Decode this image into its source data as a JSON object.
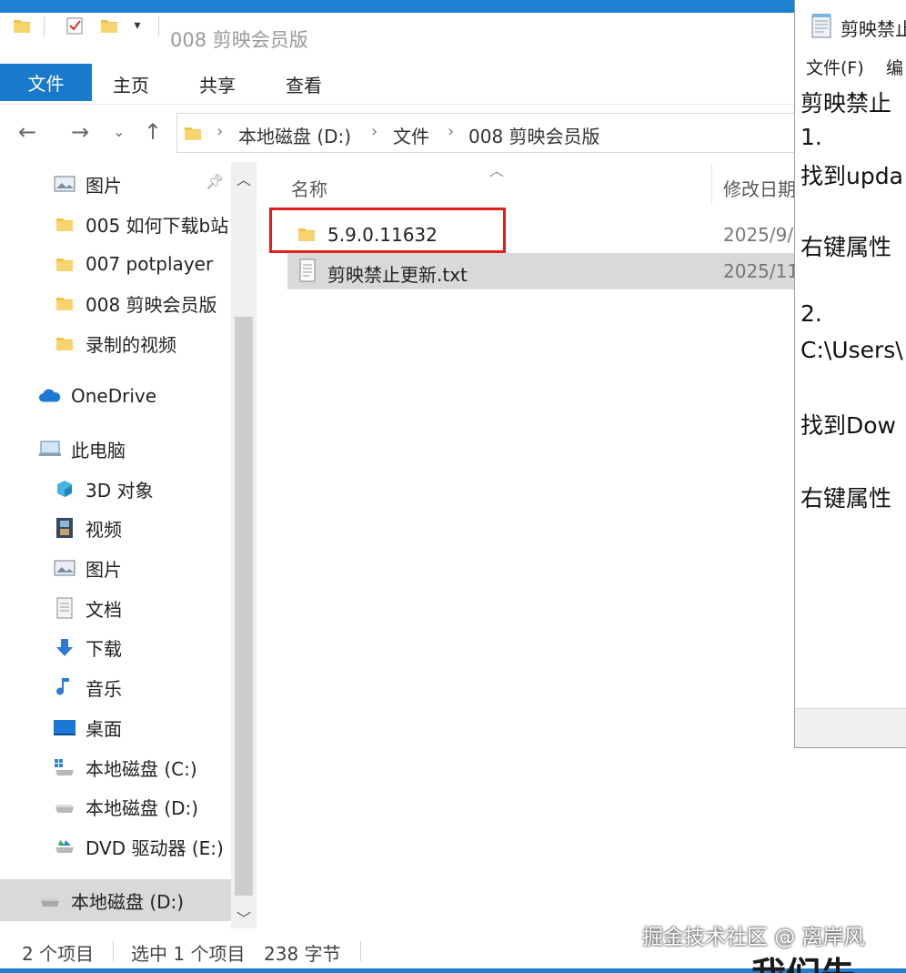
{
  "explorer": {
    "window_title": "008 剪映会员版",
    "ribbon": {
      "file_tab": "文件",
      "tabs": [
        "主页",
        "共享",
        "查看"
      ]
    },
    "breadcrumb": [
      "本地磁盘 (D:)",
      "文件",
      "008 剪映会员版"
    ],
    "nav_pane": {
      "quick_access": [
        {
          "label": "图片",
          "icon": "pictures-icon"
        },
        {
          "label": "005 如何下载b站",
          "icon": "folder-icon"
        },
        {
          "label": "007 potplayer",
          "icon": "folder-icon"
        },
        {
          "label": "008 剪映会员版",
          "icon": "folder-icon"
        },
        {
          "label": "录制的视频",
          "icon": "folder-icon"
        }
      ],
      "onedrive": "OneDrive",
      "this_pc": "此电脑",
      "pc_items": [
        {
          "label": "3D 对象",
          "icon": "3d-objects-icon"
        },
        {
          "label": "视频",
          "icon": "videos-icon"
        },
        {
          "label": "图片",
          "icon": "pictures-icon"
        },
        {
          "label": "文档",
          "icon": "documents-icon"
        },
        {
          "label": "下载",
          "icon": "downloads-icon"
        },
        {
          "label": "音乐",
          "icon": "music-icon"
        },
        {
          "label": "桌面",
          "icon": "desktop-icon"
        },
        {
          "label": "本地磁盘 (C:)",
          "icon": "drive-c-icon"
        },
        {
          "label": "本地磁盘 (D:)",
          "icon": "drive-icon"
        },
        {
          "label": "DVD 驱动器 (E:)",
          "icon": "dvd-drive-icon"
        }
      ],
      "selected_drive": "本地磁盘 (D:)"
    },
    "columns": {
      "name": "名称",
      "modified": "修改日期"
    },
    "files": [
      {
        "name": "5.9.0.11632",
        "date": "2025/9/",
        "type": "folder"
      },
      {
        "name": "剪映禁止更新.txt",
        "date": "2025/11",
        "type": "text"
      }
    ],
    "status": {
      "item_count": "2 个项目",
      "selection": "选中 1 个项目",
      "size": "238 字节"
    }
  },
  "notepad": {
    "title": "剪映禁止",
    "menu": [
      "文件(F)",
      "编"
    ],
    "lines": [
      "剪映禁止",
      "1.",
      "找到upda",
      "右键属性",
      "2.",
      "C:\\Users\\",
      "找到Dow",
      "右键属性"
    ]
  },
  "watermark": "掘金技术社区 @ 离岸风",
  "cut_caption": "我们先"
}
